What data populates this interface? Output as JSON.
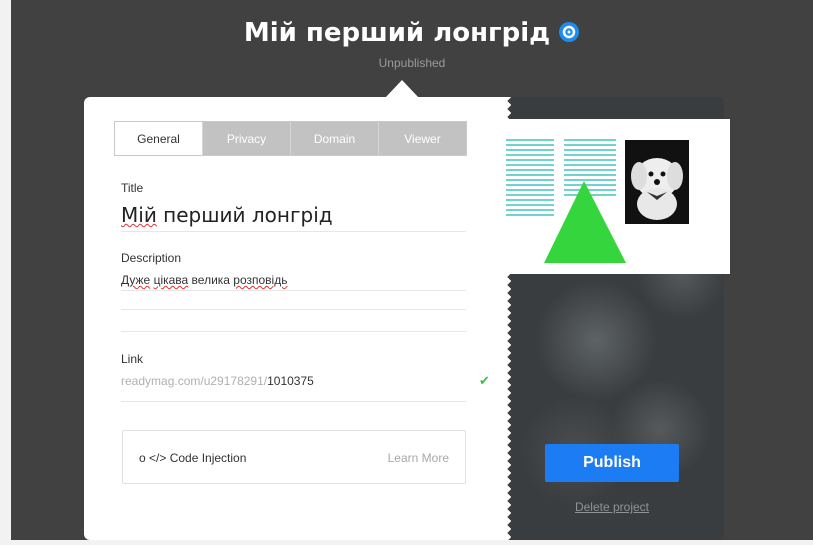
{
  "header": {
    "title": "Мій перший лонгрід",
    "status": "Unpublished"
  },
  "tabs": [
    {
      "label": "General",
      "active": true
    },
    {
      "label": "Privacy",
      "active": false
    },
    {
      "label": "Domain",
      "active": false
    },
    {
      "label": "Viewer",
      "active": false
    }
  ],
  "form": {
    "title_label": "Title",
    "title_value": "Мій перший лонгрід",
    "title_parts": [
      "Мій",
      " перший лонгрід"
    ],
    "description_label": "Description",
    "description_parts": [
      "Дуже",
      " ",
      "цікава",
      " велика ",
      "розповідь"
    ],
    "link_label": "Link",
    "link_prefix": "readymag.com/u29178291/",
    "link_slug": "1010375",
    "link_status_icon": "check-icon"
  },
  "code_injection": {
    "label": "o </> Code Injection",
    "learn_more": "Learn More"
  },
  "actions": {
    "publish": "Publish",
    "delete": "Delete project"
  },
  "colors": {
    "accent": "#1c7cf4",
    "check": "#3cbf4a",
    "background": "#414141"
  }
}
